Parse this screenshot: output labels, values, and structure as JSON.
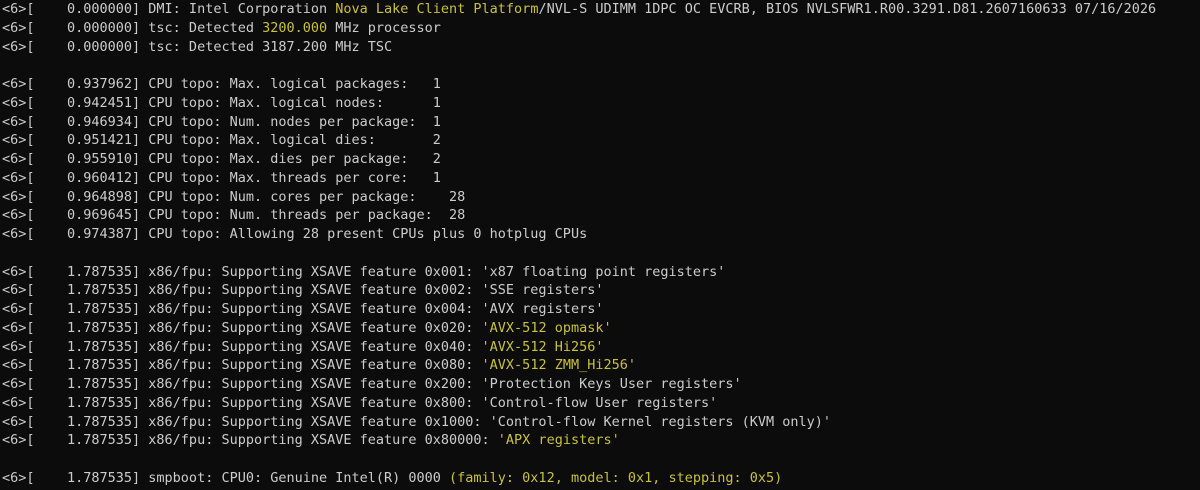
{
  "colors": {
    "background": "#0c0c0c",
    "text": "#cccccc",
    "highlight": "#c9c13a"
  },
  "lines": [
    [
      {
        "t": "<6>[    0.000000] DMI: Intel Corporation "
      },
      {
        "t": "Nova Lake Client Platform",
        "h": true
      },
      {
        "t": "/NVL-S UDIMM 1DPC OC EVCRB, BIOS NVLSFWR1.R00.3291.D81.2607160633 07/16/2026"
      }
    ],
    [
      {
        "t": "<6>[    0.000000] tsc: Detected "
      },
      {
        "t": "3200.000",
        "h": true
      },
      {
        "t": " MHz processor"
      }
    ],
    [
      {
        "t": "<6>[    0.000000] tsc: Detected 3187.200 MHz TSC"
      }
    ],
    [],
    [
      {
        "t": "<6>[    0.937962] CPU topo: Max. logical packages:   1"
      }
    ],
    [
      {
        "t": "<6>[    0.942451] CPU topo: Max. logical nodes:      1"
      }
    ],
    [
      {
        "t": "<6>[    0.946934] CPU topo: Num. nodes per package:  1"
      }
    ],
    [
      {
        "t": "<6>[    0.951421] CPU topo: Max. logical dies:       2"
      }
    ],
    [
      {
        "t": "<6>[    0.955910] CPU topo: Max. dies per package:   2"
      }
    ],
    [
      {
        "t": "<6>[    0.960412] CPU topo: Max. threads per core:   1"
      }
    ],
    [
      {
        "t": "<6>[    0.964898] CPU topo: Num. cores per package:    28"
      }
    ],
    [
      {
        "t": "<6>[    0.969645] CPU topo: Num. threads per package:  28"
      }
    ],
    [
      {
        "t": "<6>[    0.974387] CPU topo: Allowing 28 present CPUs plus 0 hotplug CPUs"
      }
    ],
    [],
    [
      {
        "t": "<6>[    1.787535] x86/fpu: Supporting XSAVE feature 0x001: 'x87 floating point registers'"
      }
    ],
    [
      {
        "t": "<6>[    1.787535] x86/fpu: Supporting XSAVE feature 0x002: 'SSE registers'"
      }
    ],
    [
      {
        "t": "<6>[    1.787535] x86/fpu: Supporting XSAVE feature 0x004: 'AVX registers'"
      }
    ],
    [
      {
        "t": "<6>[    1.787535] x86/fpu: Supporting XSAVE feature 0x020: "
      },
      {
        "t": "'AVX-512 opmask'",
        "h": true
      }
    ],
    [
      {
        "t": "<6>[    1.787535] x86/fpu: Supporting XSAVE feature 0x040: "
      },
      {
        "t": "'AVX-512 Hi256'",
        "h": true
      }
    ],
    [
      {
        "t": "<6>[    1.787535] x86/fpu: Supporting XSAVE feature 0x080: "
      },
      {
        "t": "'AVX-512 ZMM_Hi256'",
        "h": true
      }
    ],
    [
      {
        "t": "<6>[    1.787535] x86/fpu: Supporting XSAVE feature 0x200: 'Protection Keys User registers'"
      }
    ],
    [
      {
        "t": "<6>[    1.787535] x86/fpu: Supporting XSAVE feature 0x800: 'Control-flow User registers'"
      }
    ],
    [
      {
        "t": "<6>[    1.787535] x86/fpu: Supporting XSAVE feature 0x1000: 'Control-flow Kernel registers (KVM only)'"
      }
    ],
    [
      {
        "t": "<6>[    1.787535] x86/fpu: Supporting XSAVE feature 0x80000: "
      },
      {
        "t": "'APX registers'",
        "h": true
      }
    ],
    [],
    [
      {
        "t": "<6>[    1.787535] smpboot: CPU0: Genuine Intel(R) 0000 "
      },
      {
        "t": "(family: 0x12, model: 0x1, stepping: 0x5)",
        "h": true
      }
    ]
  ]
}
